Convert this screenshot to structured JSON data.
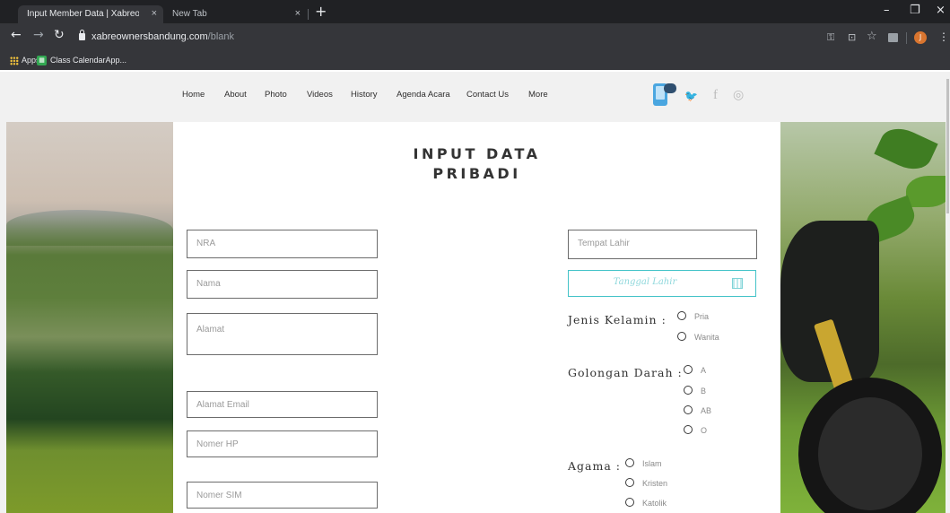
{
  "browser": {
    "tabs": [
      {
        "title": "Input Member Data | Xabreowne",
        "close": "×"
      },
      {
        "title": "New Tab",
        "close": "×"
      }
    ],
    "new_tab": "+",
    "window_controls": {
      "minimize": "–",
      "maximize": "❐",
      "close": "×"
    },
    "nav": {
      "back": "←",
      "forward": "→",
      "reload": "↻"
    },
    "url": {
      "host": "xabreownersbandung.com",
      "path": "/blank"
    },
    "toolbar_icons": {
      "key": "⚿",
      "translate": "⊡",
      "star": "☆",
      "profile": "J",
      "menu": "⋮"
    },
    "bookmarks": [
      {
        "label": "Apps",
        "icon": "apps-grid-icon"
      },
      {
        "label": "Class CalendarApp...",
        "icon": "calendar-app-icon"
      }
    ]
  },
  "site": {
    "nav": [
      "Home",
      "About",
      "Photo",
      "Videos",
      "History",
      "Agenda Acara",
      "Contact Us",
      "More"
    ],
    "social_icons": [
      "app-icon",
      "twitter-icon",
      "facebook-icon",
      "instagram-icon"
    ],
    "social_glyphs": {
      "twitter": "🐦",
      "facebook": "f",
      "instagram": "◎"
    },
    "title_line1": "INPUT DATA",
    "title_line2": "PRIBADI",
    "form": {
      "nra": "NRA",
      "nama": "Nama",
      "alamat": "Alamat",
      "email": "Alamat Email",
      "hp": "Nomer HP",
      "sim": "Nomer SIM",
      "tempat_lahir": "Tempat Lahir",
      "tanggal_lahir": "Tanggal Lahir",
      "jenis_kelamin": {
        "label": "Jenis Kelamin :",
        "options": [
          "Pria",
          "Wanita"
        ]
      },
      "golongan_darah": {
        "label": "Golongan Darah :",
        "options": [
          "A",
          "B",
          "AB",
          "O"
        ]
      },
      "agama": {
        "label": "Agama :",
        "options": [
          "Islam",
          "Kristen",
          "Katolik"
        ]
      }
    }
  },
  "colors": {
    "accent": "#44c3c8",
    "chrome_dark": "#202124",
    "chrome": "#35363a"
  }
}
